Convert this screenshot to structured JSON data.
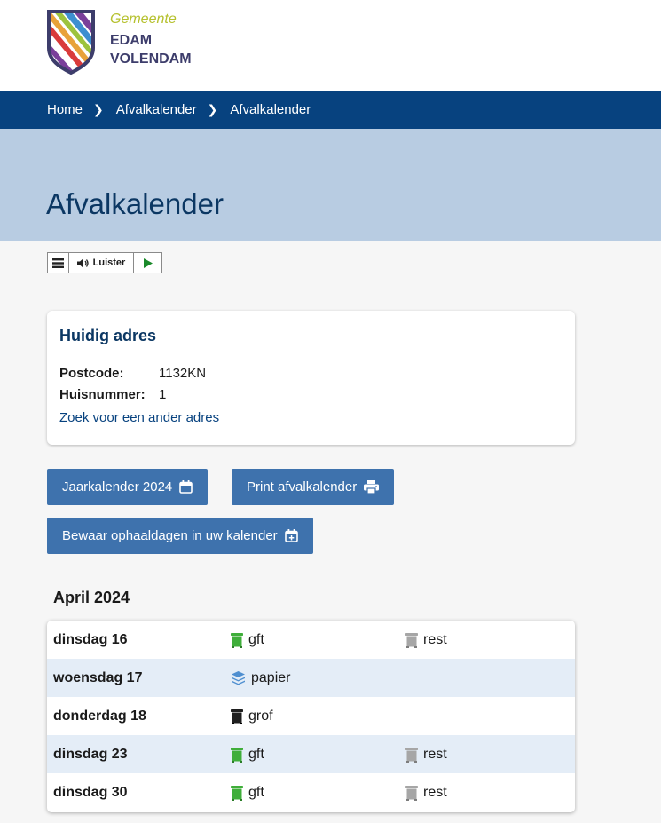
{
  "header": {
    "logo_gemeente": "Gemeente",
    "logo_line1": "EDAM",
    "logo_line2": "VOLENDAM"
  },
  "breadcrumb": {
    "items": [
      "Home",
      "Afvalkalender",
      "Afvalkalender"
    ]
  },
  "page": {
    "title": "Afvalkalender"
  },
  "readspeaker": {
    "listen_label": "Luister"
  },
  "address": {
    "title": "Huidig adres",
    "postcode_label": "Postcode:",
    "postcode_value": "1132KN",
    "huisnummer_label": "Huisnummer:",
    "huisnummer_value": "1",
    "change_link": "Zoek voor een ander adres"
  },
  "buttons": {
    "year_calendar": "Jaarkalender 2024",
    "print": "Print afvalkalender",
    "save": "Bewaar ophaaldagen in uw kalender"
  },
  "calendar": {
    "month": "April 2024",
    "rows": [
      {
        "day": "dinsdag 16",
        "items": [
          {
            "type": "gft",
            "icon": "green-bin-icon"
          },
          {
            "type": "rest",
            "icon": "grey-bin-icon"
          }
        ]
      },
      {
        "day": "woensdag 17",
        "items": [
          {
            "type": "papier",
            "icon": "paper-stack-icon"
          }
        ]
      },
      {
        "day": "donderdag 18",
        "items": [
          {
            "type": "grof",
            "icon": "black-bin-icon"
          }
        ]
      },
      {
        "day": "dinsdag 23",
        "items": [
          {
            "type": "gft",
            "icon": "green-bin-icon"
          },
          {
            "type": "rest",
            "icon": "grey-bin-icon"
          }
        ]
      },
      {
        "day": "dinsdag 30",
        "items": [
          {
            "type": "gft",
            "icon": "green-bin-icon"
          },
          {
            "type": "rest",
            "icon": "grey-bin-icon"
          }
        ]
      }
    ]
  },
  "colors": {
    "brand_blue": "#07427f",
    "hero_blue": "#b8cce2",
    "button_blue": "#3e72ad",
    "gft_green": "#3fae3a",
    "rest_grey": "#a6a6a6",
    "paper_blue": "#4f8fd0",
    "grof_black": "#1e1e1e",
    "row_alt": "#e4edf7"
  }
}
